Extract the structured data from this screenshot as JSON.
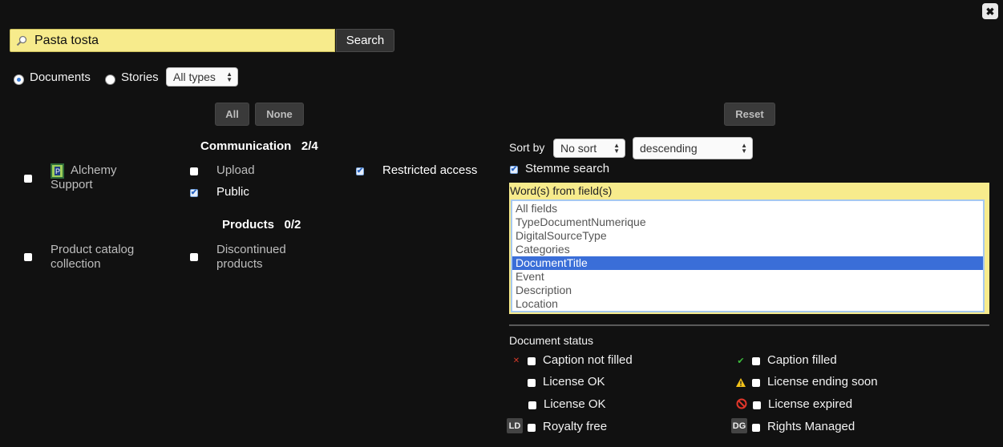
{
  "close": {
    "icon": "close-icon",
    "glyph": "✖"
  },
  "search": {
    "value": "Pasta tosta",
    "button": "Search"
  },
  "scope": {
    "documents": "Documents",
    "stories": "Stories",
    "types_select": "All types"
  },
  "selection": {
    "all": "All",
    "none": "None",
    "reset": "Reset"
  },
  "groups": [
    {
      "title": "Communication",
      "count": "2/4",
      "collections": [
        {
          "label": "Alchemy Support",
          "checked": false
        },
        {
          "label": "Upload",
          "checked": false
        },
        {
          "label": "Public",
          "checked": true
        },
        {
          "label": "Restricted access",
          "checked": true
        }
      ]
    },
    {
      "title": "Products",
      "count": "0/2",
      "collections": [
        {
          "label": "Product catalog collection",
          "checked": false
        },
        {
          "label": "Discontinued products",
          "checked": false
        }
      ]
    }
  ],
  "sort": {
    "label": "Sort by",
    "field": "No sort",
    "order": "descending",
    "stemme_label": "Stemme search",
    "stemme_checked": true
  },
  "fields": {
    "title": "Word(s) from field(s)",
    "items": [
      "All fields",
      "TypeDocumentNumerique",
      "DigitalSourceType",
      "Categories",
      "DocumentTitle",
      "Event",
      "Description",
      "Location"
    ],
    "selected": "DocumentTitle"
  },
  "status": {
    "title": "Document status",
    "items": [
      {
        "label": "Caption not filled",
        "icon": "x-icon"
      },
      {
        "label": "Caption filled",
        "icon": "checkmark-icon"
      },
      {
        "label": "License OK",
        "icon": ""
      },
      {
        "label": "License ending soon",
        "icon": "warning-icon"
      },
      {
        "label": "License OK",
        "icon": ""
      },
      {
        "label": "License expired",
        "icon": "no-entry-icon"
      },
      {
        "label": "Royalty free",
        "icon": "LD"
      },
      {
        "label": "Rights Managed",
        "icon": "DG"
      }
    ]
  },
  "colors": {
    "background": "#111111",
    "search_bg": "#f7eb8c",
    "selection_blue": "#3a6ed8"
  }
}
